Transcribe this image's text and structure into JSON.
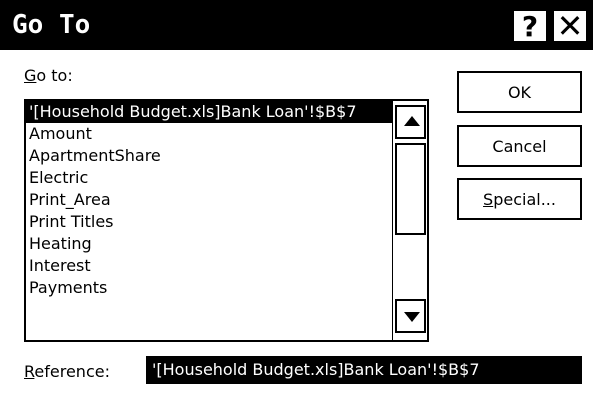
{
  "window": {
    "title": "Go To",
    "help_label": "?",
    "close_label": "✕"
  },
  "goto": {
    "label_accel": "G",
    "label_rest": "o to:",
    "items": [
      {
        "label": "'[Household Budget.xls]Bank Loan'!$B$7",
        "selected": true
      },
      {
        "label": "Amount"
      },
      {
        "label": "ApartmentShare"
      },
      {
        "label": "Electric"
      },
      {
        "label": "Print_Area"
      },
      {
        "label": "Print Titles"
      },
      {
        "label": "Heating"
      },
      {
        "label": "Interest"
      },
      {
        "label": "Payments"
      }
    ]
  },
  "buttons": {
    "ok": "OK",
    "cancel": "Cancel",
    "special_accel": "S",
    "special_rest": "pecial..."
  },
  "reference": {
    "label_accel": "R",
    "label_rest": "eference:",
    "value": "'[Household Budget.xls]Bank Loan'!$B$7"
  },
  "icons": {
    "scroll_up": "arrow-up-icon",
    "scroll_down": "arrow-down-icon",
    "close": "close-icon",
    "help": "help-icon"
  }
}
